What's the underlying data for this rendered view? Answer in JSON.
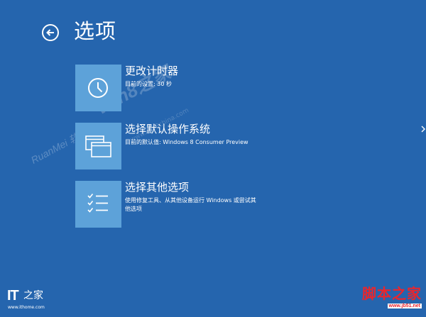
{
  "header": {
    "title": "选项"
  },
  "options": [
    {
      "title": "更改计时器",
      "description": "目前的设置: 30 秒",
      "icon": "clock-icon"
    },
    {
      "title": "选择默认操作系统",
      "description": "目前的默认值: Windows 8 Consumer Preview",
      "icon": "windows-stack-icon"
    },
    {
      "title": "选择其他选项",
      "description": "使用修复工具、从其他设备运行 Windows 或尝试其他选项",
      "icon": "checklist-icon"
    }
  ],
  "watermarks": {
    "site": "Win8之家",
    "ruan": "RuanMei 软媒",
    "url": "www.win8china.com"
  },
  "logos": {
    "it_letters": "IT",
    "it_chinese": "之家",
    "it_url": "www.ithome.com",
    "jb_chinese": "脚本之家",
    "jb_url": "www.jb51.net"
  },
  "colors": {
    "background": "#2565ae",
    "tile": "#5da2d9",
    "text": "#ffffff"
  }
}
